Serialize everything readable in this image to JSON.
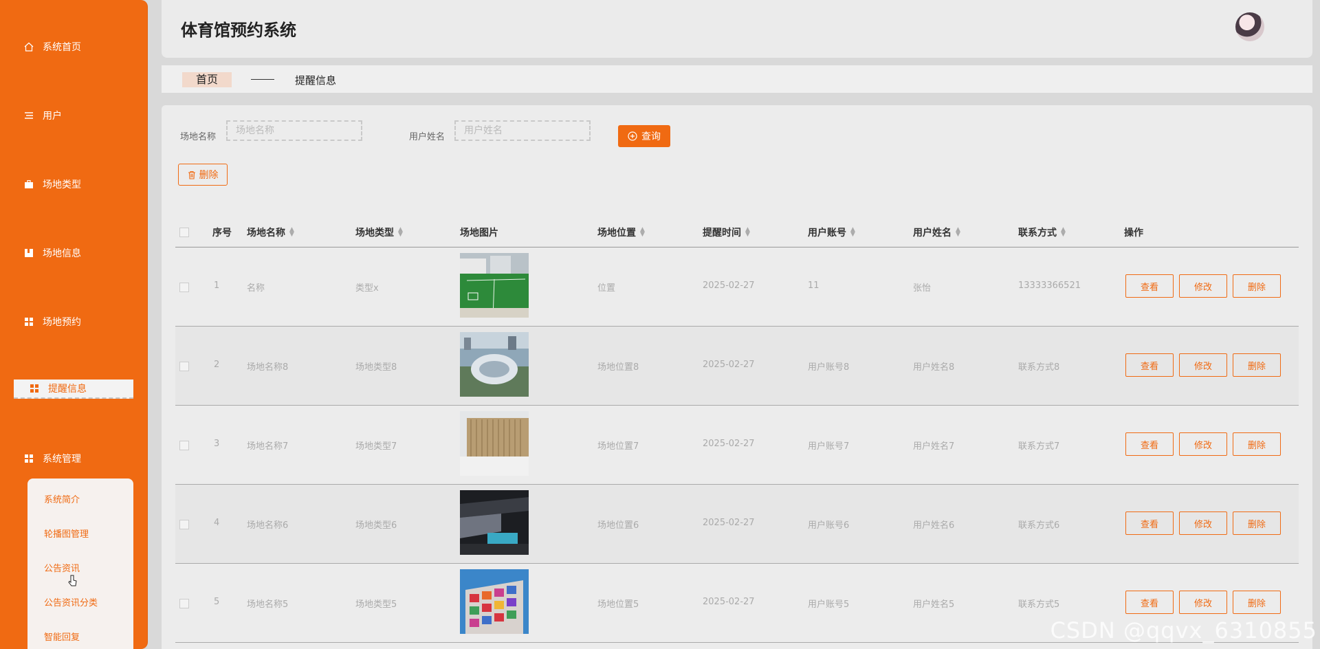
{
  "sidebar": {
    "items": [
      {
        "label": "系统首页",
        "icon": "home-icon"
      },
      {
        "label": "用户",
        "icon": "list-icon"
      },
      {
        "label": "场地类型",
        "icon": "briefcase-icon"
      },
      {
        "label": "场地信息",
        "icon": "book-icon"
      },
      {
        "label": "场地预约",
        "icon": "grid-icon"
      },
      {
        "label": "提醒信息",
        "icon": "grid-icon",
        "active": true
      },
      {
        "label": "系统管理",
        "icon": "grid-icon"
      }
    ],
    "submenu": [
      "系统简介",
      "轮播图管理",
      "公告资讯",
      "公告资讯分类",
      "智能回复"
    ]
  },
  "header": {
    "title": "体育馆预约系统"
  },
  "breadcrumb": {
    "home": "首页",
    "current": "提醒信息"
  },
  "search": {
    "venue_label": "场地名称",
    "venue_placeholder": "场地名称",
    "user_label": "用户姓名",
    "user_placeholder": "用户姓名",
    "query_label": "查询"
  },
  "toolbar": {
    "delete_label": "删除"
  },
  "table": {
    "headers": [
      "序号",
      "场地名称",
      "场地类型",
      "场地图片",
      "场地位置",
      "提醒时间",
      "用户账号",
      "用户姓名",
      "联系方式",
      "操作"
    ],
    "actions": {
      "view": "查看",
      "edit": "修改",
      "delete": "删除"
    },
    "rows": [
      {
        "index": "1",
        "name": "名称",
        "type": "类型x",
        "location": "位置",
        "time": "2025-02-27",
        "account": "11",
        "username": "张怡",
        "contact": "13333366521",
        "image": "soccer-field"
      },
      {
        "index": "2",
        "name": "场地名称8",
        "type": "场地类型8",
        "location": "场地位置8",
        "time": "2025-02-27",
        "account": "用户账号8",
        "username": "用户姓名8",
        "contact": "联系方式8",
        "image": "stadium-aerial"
      },
      {
        "index": "3",
        "name": "场地名称7",
        "type": "场地类型7",
        "location": "场地位置7",
        "time": "2025-02-27",
        "account": "用户账号7",
        "username": "用户姓名7",
        "contact": "联系方式7",
        "image": "wooden-building"
      },
      {
        "index": "4",
        "name": "场地名称6",
        "type": "场地类型6",
        "location": "场地位置6",
        "time": "2025-02-27",
        "account": "用户账号6",
        "username": "用户姓名6",
        "contact": "联系方式6",
        "image": "indoor-pool"
      },
      {
        "index": "5",
        "name": "场地名称5",
        "type": "场地类型5",
        "location": "场地位置5",
        "time": "2025-02-27",
        "account": "用户账号5",
        "username": "用户姓名5",
        "contact": "联系方式5",
        "image": "colorful-building"
      }
    ]
  },
  "watermark": "CSDN @qqvx_6310855",
  "colors": {
    "accent": "#f06a12",
    "panel": "#ececec",
    "sidebar": "#f06a12"
  }
}
